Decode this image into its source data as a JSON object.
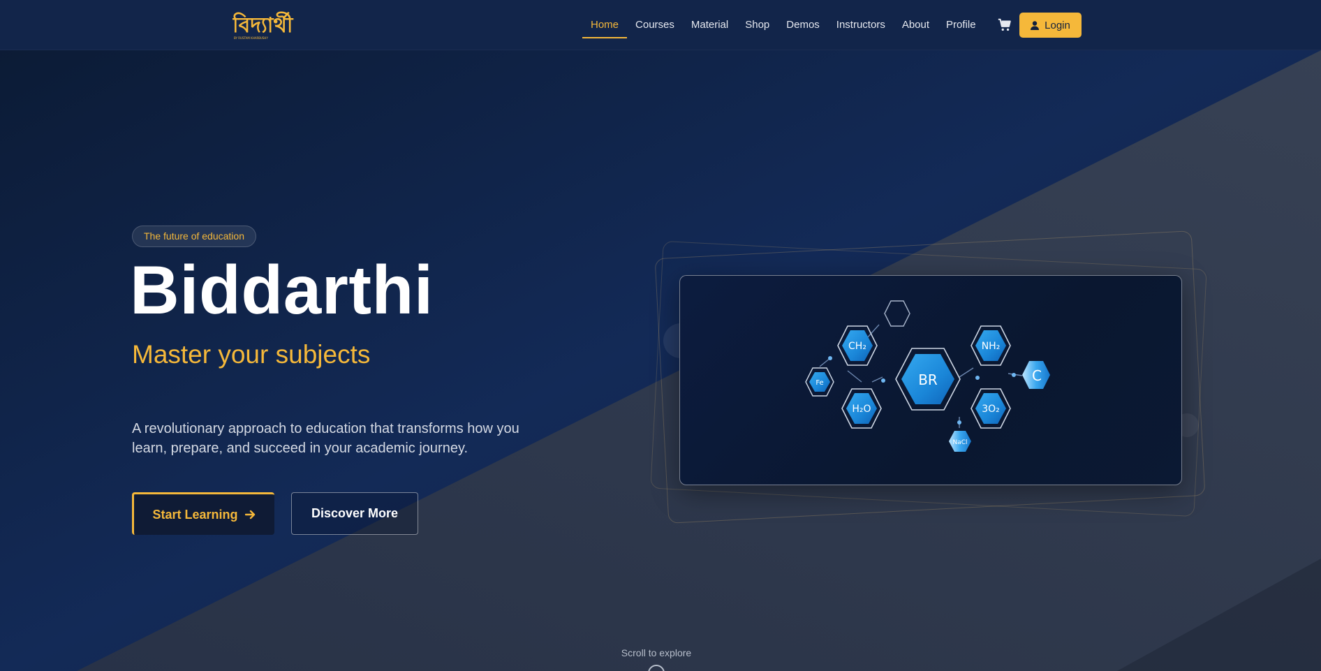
{
  "nav": {
    "logo_text": "বিদ্যার্থী",
    "items": [
      {
        "label": "Home",
        "active": true
      },
      {
        "label": "Courses"
      },
      {
        "label": "Material"
      },
      {
        "label": "Shop"
      },
      {
        "label": "Demos"
      },
      {
        "label": "Instructors"
      },
      {
        "label": "About"
      },
      {
        "label": "Profile"
      }
    ],
    "cart_icon": "cart-icon",
    "login_label": "Login"
  },
  "hero": {
    "badge": "The future of education",
    "title": "Biddarthi",
    "subtitle": "Master your subjects",
    "description": "A revolutionary approach to education that transforms how you learn, prepare, and succeed in your academic journey.",
    "primary_button": "Start Learning",
    "secondary_button": "Discover More"
  },
  "molecule": {
    "center": "BR",
    "nodes": [
      "CH",
      "NH",
      "Fe",
      "C",
      "H",
      "O",
      "3O",
      "NaCl"
    ]
  },
  "scroll_hint": "Scroll to explore",
  "colors": {
    "accent": "#f5b83a",
    "background": "#0d1b33",
    "nav": "#12254a"
  }
}
